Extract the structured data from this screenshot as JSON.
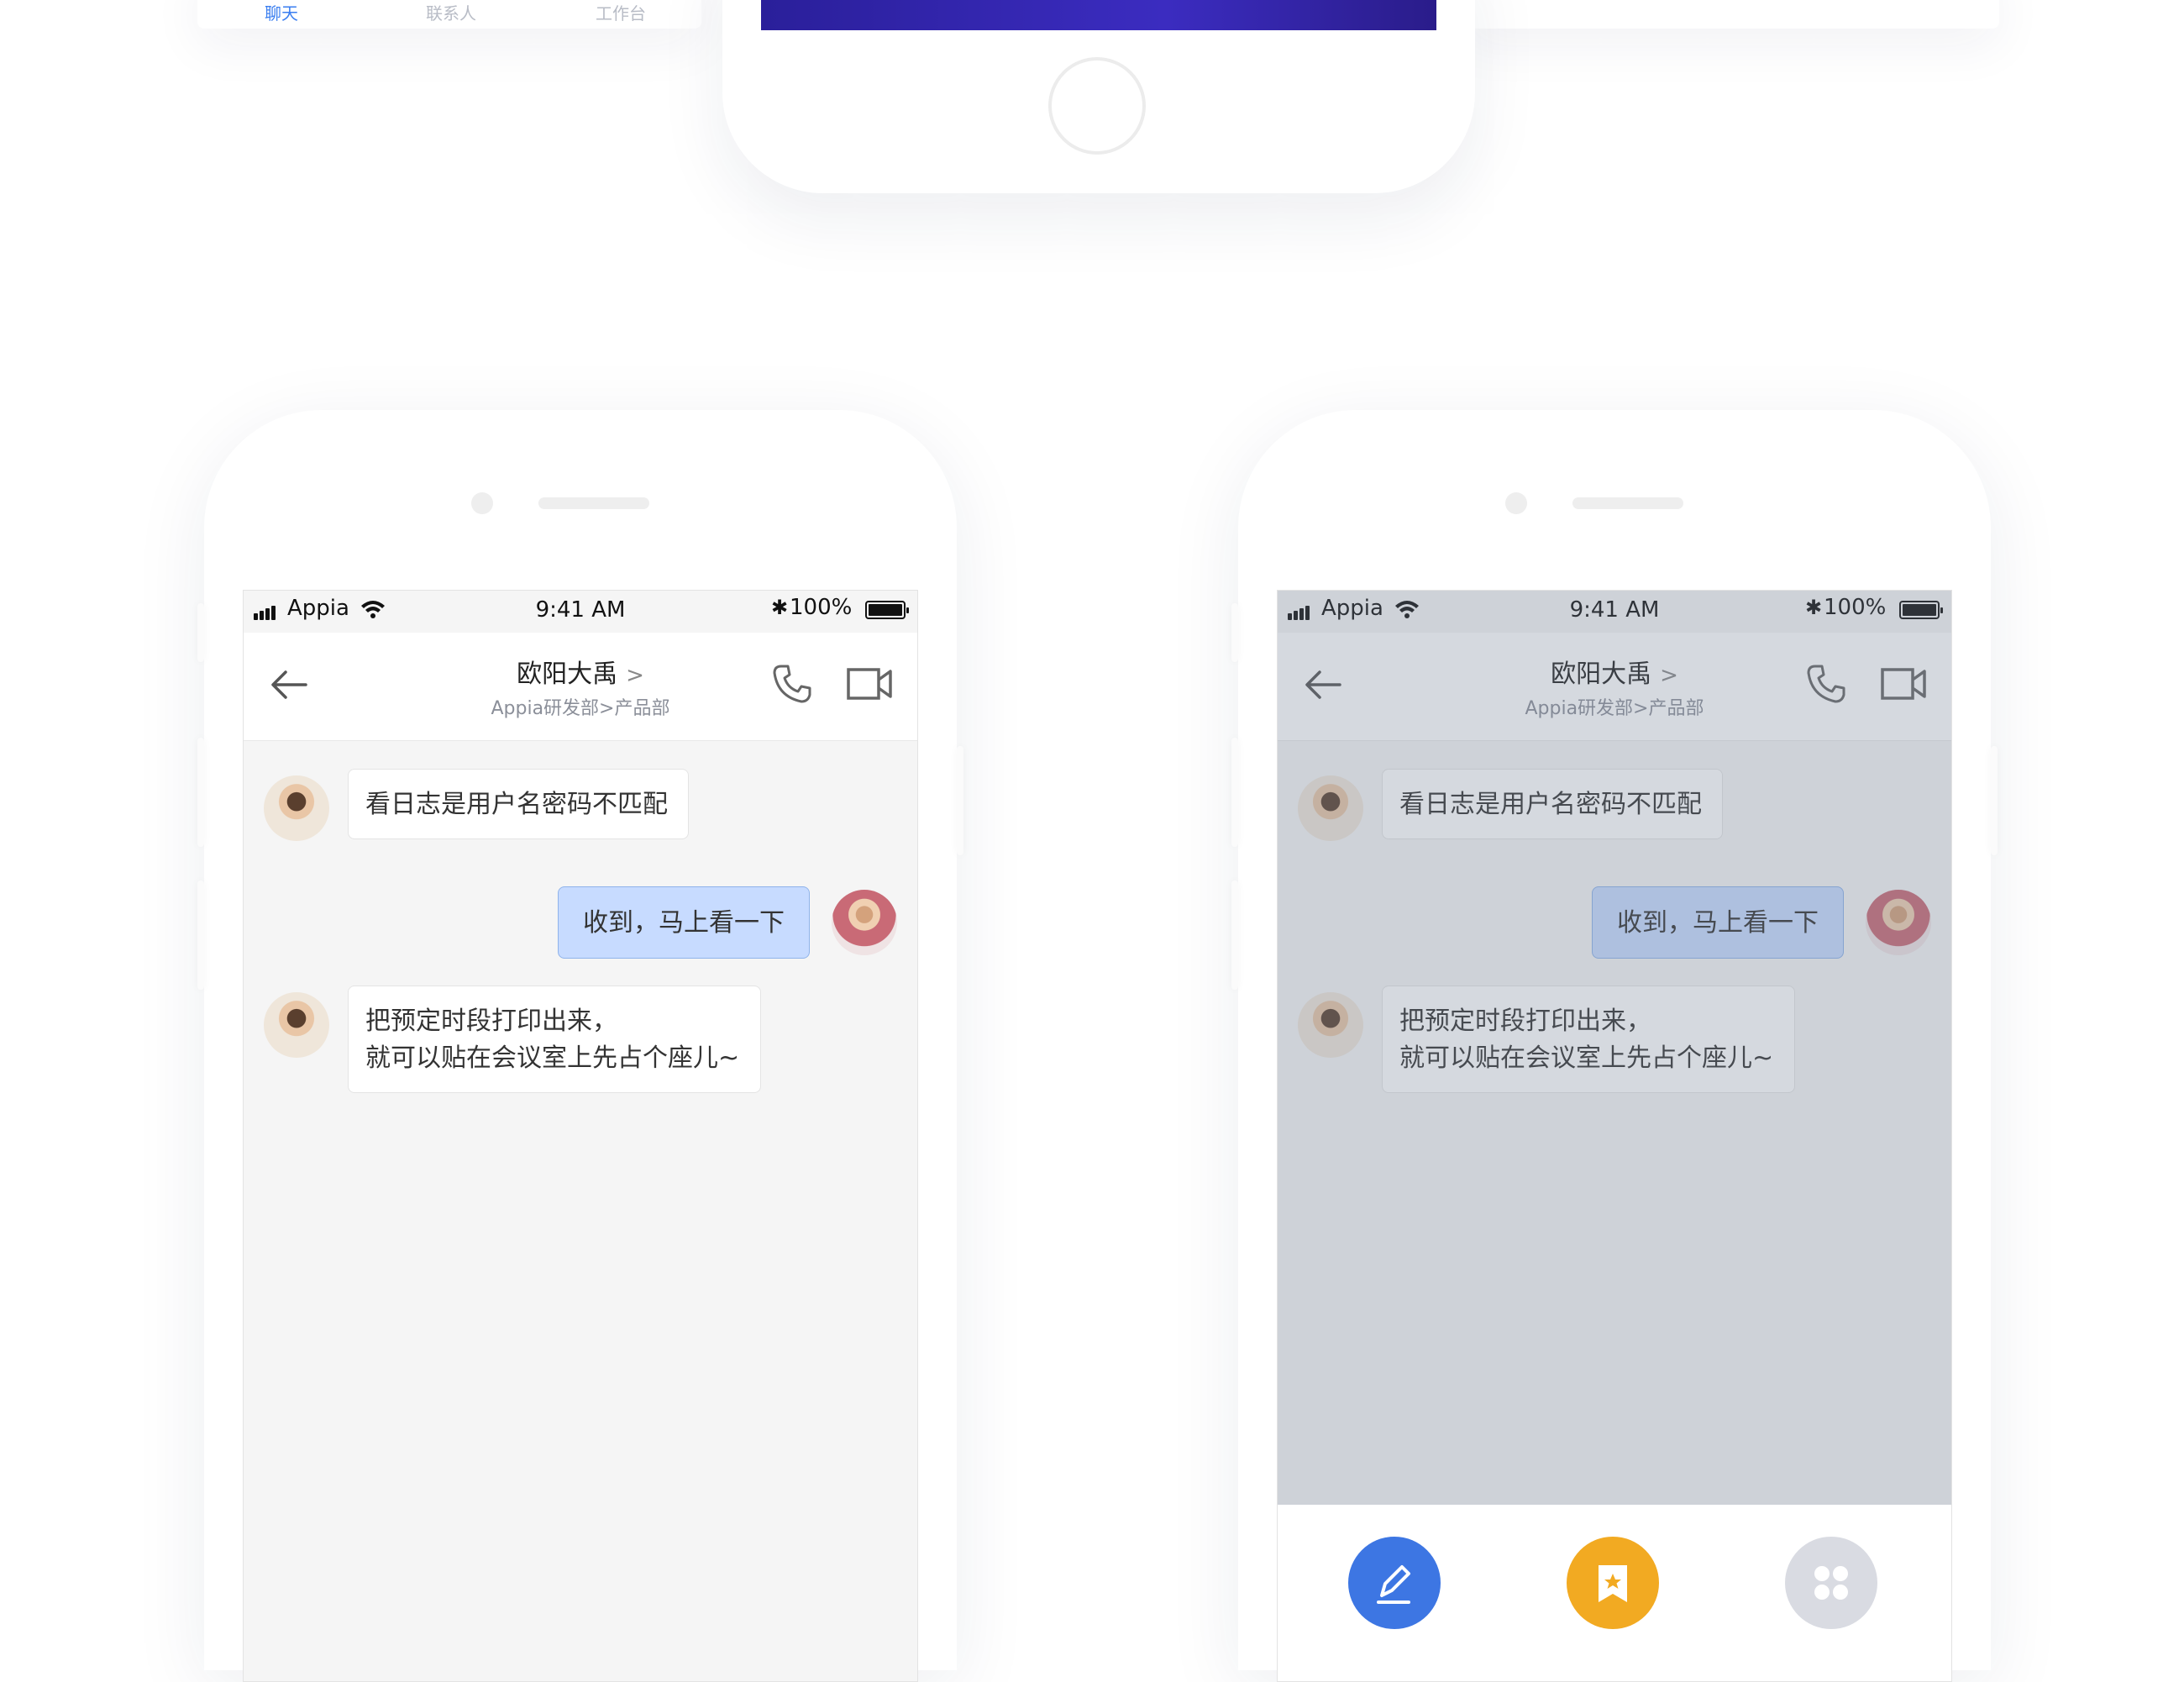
{
  "top_tabbar": {
    "tabs": [
      {
        "label": "聊天",
        "active": true
      },
      {
        "label": "联系人",
        "active": false
      },
      {
        "label": "工作台",
        "active": false
      }
    ]
  },
  "phones": [
    {
      "status": {
        "carrier": "Appia",
        "time": "9:41 AM",
        "bluetooth": "✱",
        "battery": "100%"
      },
      "header": {
        "title": "欧阳大禹",
        "chevron": ">",
        "subtitle": "Appia研发部>产品部"
      },
      "messages": [
        {
          "from": "other",
          "text": "看日志是用户名密码不匹配"
        },
        {
          "from": "me",
          "text": "收到，马上看一下"
        },
        {
          "from": "other",
          "lines": [
            "把预定时段打印出来，",
            "就可以贴在会议室上先占个座儿~"
          ]
        }
      ]
    },
    {
      "status": {
        "carrier": "Appia",
        "time": "9:41 AM",
        "bluetooth": "✱",
        "battery": "100%"
      },
      "header": {
        "title": "欧阳大禹",
        "chevron": ">",
        "subtitle": "Appia研发部>产品部"
      },
      "messages": [
        {
          "from": "other",
          "text": "看日志是用户名密码不匹配"
        },
        {
          "from": "me",
          "text": "收到，马上看一下"
        },
        {
          "from": "other",
          "lines": [
            "把预定时段打印出来，",
            "就可以贴在会议室上先占个座儿~"
          ]
        }
      ],
      "action_sheet": {
        "buttons": [
          {
            "icon": "pen-icon",
            "color": "#3d76e3"
          },
          {
            "icon": "bookmark-star-icon",
            "color": "#f2aa22"
          },
          {
            "icon": "grid-icon",
            "color": "#d9dbe2"
          }
        ]
      }
    }
  ],
  "colors": {
    "accent": "#3a7ef0",
    "bubble_me": "#c7dbff",
    "overlay": "#9aa3b2"
  }
}
